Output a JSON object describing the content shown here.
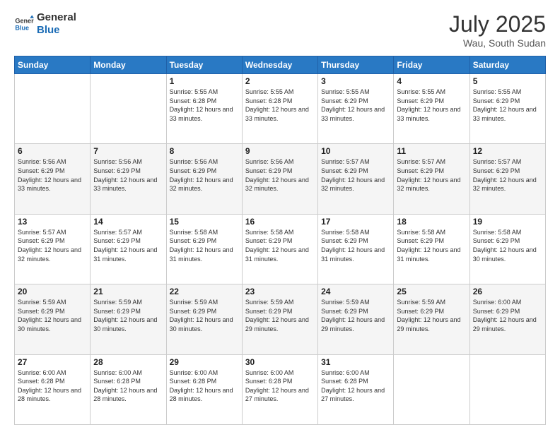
{
  "logo": {
    "line1": "General",
    "line2": "Blue"
  },
  "title": "July 2025",
  "location": "Wau, South Sudan",
  "days_header": [
    "Sunday",
    "Monday",
    "Tuesday",
    "Wednesday",
    "Thursday",
    "Friday",
    "Saturday"
  ],
  "weeks": [
    [
      {
        "day": "",
        "info": ""
      },
      {
        "day": "",
        "info": ""
      },
      {
        "day": "1",
        "info": "Sunrise: 5:55 AM\nSunset: 6:28 PM\nDaylight: 12 hours and 33 minutes."
      },
      {
        "day": "2",
        "info": "Sunrise: 5:55 AM\nSunset: 6:28 PM\nDaylight: 12 hours and 33 minutes."
      },
      {
        "day": "3",
        "info": "Sunrise: 5:55 AM\nSunset: 6:29 PM\nDaylight: 12 hours and 33 minutes."
      },
      {
        "day": "4",
        "info": "Sunrise: 5:55 AM\nSunset: 6:29 PM\nDaylight: 12 hours and 33 minutes."
      },
      {
        "day": "5",
        "info": "Sunrise: 5:55 AM\nSunset: 6:29 PM\nDaylight: 12 hours and 33 minutes."
      }
    ],
    [
      {
        "day": "6",
        "info": "Sunrise: 5:56 AM\nSunset: 6:29 PM\nDaylight: 12 hours and 33 minutes."
      },
      {
        "day": "7",
        "info": "Sunrise: 5:56 AM\nSunset: 6:29 PM\nDaylight: 12 hours and 33 minutes."
      },
      {
        "day": "8",
        "info": "Sunrise: 5:56 AM\nSunset: 6:29 PM\nDaylight: 12 hours and 32 minutes."
      },
      {
        "day": "9",
        "info": "Sunrise: 5:56 AM\nSunset: 6:29 PM\nDaylight: 12 hours and 32 minutes."
      },
      {
        "day": "10",
        "info": "Sunrise: 5:57 AM\nSunset: 6:29 PM\nDaylight: 12 hours and 32 minutes."
      },
      {
        "day": "11",
        "info": "Sunrise: 5:57 AM\nSunset: 6:29 PM\nDaylight: 12 hours and 32 minutes."
      },
      {
        "day": "12",
        "info": "Sunrise: 5:57 AM\nSunset: 6:29 PM\nDaylight: 12 hours and 32 minutes."
      }
    ],
    [
      {
        "day": "13",
        "info": "Sunrise: 5:57 AM\nSunset: 6:29 PM\nDaylight: 12 hours and 32 minutes."
      },
      {
        "day": "14",
        "info": "Sunrise: 5:57 AM\nSunset: 6:29 PM\nDaylight: 12 hours and 31 minutes."
      },
      {
        "day": "15",
        "info": "Sunrise: 5:58 AM\nSunset: 6:29 PM\nDaylight: 12 hours and 31 minutes."
      },
      {
        "day": "16",
        "info": "Sunrise: 5:58 AM\nSunset: 6:29 PM\nDaylight: 12 hours and 31 minutes."
      },
      {
        "day": "17",
        "info": "Sunrise: 5:58 AM\nSunset: 6:29 PM\nDaylight: 12 hours and 31 minutes."
      },
      {
        "day": "18",
        "info": "Sunrise: 5:58 AM\nSunset: 6:29 PM\nDaylight: 12 hours and 31 minutes."
      },
      {
        "day": "19",
        "info": "Sunrise: 5:58 AM\nSunset: 6:29 PM\nDaylight: 12 hours and 30 minutes."
      }
    ],
    [
      {
        "day": "20",
        "info": "Sunrise: 5:59 AM\nSunset: 6:29 PM\nDaylight: 12 hours and 30 minutes."
      },
      {
        "day": "21",
        "info": "Sunrise: 5:59 AM\nSunset: 6:29 PM\nDaylight: 12 hours and 30 minutes."
      },
      {
        "day": "22",
        "info": "Sunrise: 5:59 AM\nSunset: 6:29 PM\nDaylight: 12 hours and 30 minutes."
      },
      {
        "day": "23",
        "info": "Sunrise: 5:59 AM\nSunset: 6:29 PM\nDaylight: 12 hours and 29 minutes."
      },
      {
        "day": "24",
        "info": "Sunrise: 5:59 AM\nSunset: 6:29 PM\nDaylight: 12 hours and 29 minutes."
      },
      {
        "day": "25",
        "info": "Sunrise: 5:59 AM\nSunset: 6:29 PM\nDaylight: 12 hours and 29 minutes."
      },
      {
        "day": "26",
        "info": "Sunrise: 6:00 AM\nSunset: 6:29 PM\nDaylight: 12 hours and 29 minutes."
      }
    ],
    [
      {
        "day": "27",
        "info": "Sunrise: 6:00 AM\nSunset: 6:28 PM\nDaylight: 12 hours and 28 minutes."
      },
      {
        "day": "28",
        "info": "Sunrise: 6:00 AM\nSunset: 6:28 PM\nDaylight: 12 hours and 28 minutes."
      },
      {
        "day": "29",
        "info": "Sunrise: 6:00 AM\nSunset: 6:28 PM\nDaylight: 12 hours and 28 minutes."
      },
      {
        "day": "30",
        "info": "Sunrise: 6:00 AM\nSunset: 6:28 PM\nDaylight: 12 hours and 27 minutes."
      },
      {
        "day": "31",
        "info": "Sunrise: 6:00 AM\nSunset: 6:28 PM\nDaylight: 12 hours and 27 minutes."
      },
      {
        "day": "",
        "info": ""
      },
      {
        "day": "",
        "info": ""
      }
    ]
  ]
}
